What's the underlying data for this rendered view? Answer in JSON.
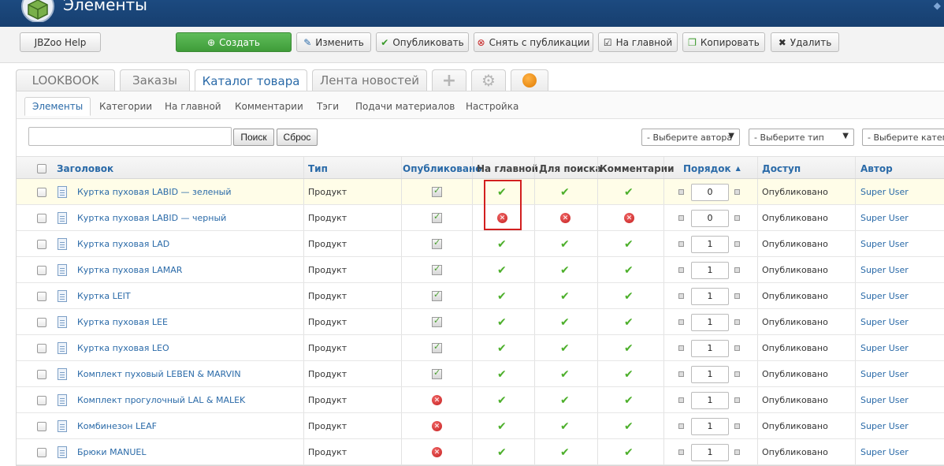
{
  "header": {
    "title": "Элементы",
    "logo_icon": "box-icon",
    "accent": "#1c4a80"
  },
  "toolbar": {
    "help_label": "JBZoo Help",
    "create_label": "Создать",
    "edit_label": "Изменить",
    "publish_label": "Опубликовать",
    "unpublish_label": "Снять с публикации",
    "featured_label": "На главной",
    "copy_label": "Копировать",
    "delete_label": "Удалить"
  },
  "app_tabs": [
    {
      "label": "LOOKBOOK",
      "active": false
    },
    {
      "label": "Заказы",
      "active": false
    },
    {
      "label": "Каталог товара",
      "active": true
    },
    {
      "label": "Лента новостей",
      "active": false
    }
  ],
  "app_tab_icons": [
    "plus-icon",
    "gear-icon",
    "puzzle-icon"
  ],
  "subtabs": [
    {
      "label": "Элементы",
      "active": true
    },
    {
      "label": "Категории",
      "active": false
    },
    {
      "label": "На главной",
      "active": false
    },
    {
      "label": "Комментарии",
      "active": false
    },
    {
      "label": "Тэги",
      "active": false
    },
    {
      "label": "Подачи материалов",
      "active": false
    },
    {
      "label": "Настройка",
      "active": false
    }
  ],
  "filters": {
    "search_value": "",
    "search_button": "Поиск",
    "reset_button": "Сброс",
    "author_select": "- Выберите автора",
    "type_select": "- Выберите тип",
    "category_select": "- Выберите категорию"
  },
  "columns": {
    "title": "Заголовок",
    "type": "Тип",
    "published": "Опубликовано",
    "frontpage": "На главной",
    "searchable": "Для поиска",
    "comments": "Комментарии",
    "order": "Порядок",
    "access": "Доступ",
    "author": "Автор"
  },
  "rows": [
    {
      "title": "Куртка пуховая LABID — зеленый",
      "type": "Продукт",
      "published": true,
      "frontpage": true,
      "searchable": true,
      "comments": true,
      "order": "0",
      "access": "Опубликовано",
      "author": "Super User",
      "highlight": true
    },
    {
      "title": "Куртка пуховая LABID — черный",
      "type": "Продукт",
      "published": true,
      "frontpage": false,
      "searchable": false,
      "comments": false,
      "order": "0",
      "access": "Опубликовано",
      "author": "Super User",
      "highlight": false
    },
    {
      "title": "Куртка пуховая LAD",
      "type": "Продукт",
      "published": true,
      "frontpage": true,
      "searchable": true,
      "comments": true,
      "order": "1",
      "access": "Опубликовано",
      "author": "Super User",
      "highlight": false
    },
    {
      "title": "Куртка пуховая LAMAR",
      "type": "Продукт",
      "published": true,
      "frontpage": true,
      "searchable": true,
      "comments": true,
      "order": "1",
      "access": "Опубликовано",
      "author": "Super User",
      "highlight": false
    },
    {
      "title": "Куртка LEIT",
      "type": "Продукт",
      "published": true,
      "frontpage": true,
      "searchable": true,
      "comments": true,
      "order": "1",
      "access": "Опубликовано",
      "author": "Super User",
      "highlight": false
    },
    {
      "title": "Куртка пуховая LEE",
      "type": "Продукт",
      "published": true,
      "frontpage": true,
      "searchable": true,
      "comments": true,
      "order": "1",
      "access": "Опубликовано",
      "author": "Super User",
      "highlight": false
    },
    {
      "title": "Куртка пуховая LEO",
      "type": "Продукт",
      "published": true,
      "frontpage": true,
      "searchable": true,
      "comments": true,
      "order": "1",
      "access": "Опубликовано",
      "author": "Super User",
      "highlight": false
    },
    {
      "title": "Комплект пуховый LEBEN & MARVIN",
      "type": "Продукт",
      "published": true,
      "frontpage": true,
      "searchable": true,
      "comments": true,
      "order": "1",
      "access": "Опубликовано",
      "author": "Super User",
      "highlight": false
    },
    {
      "title": "Комплект прогулочный LAL & MALEK",
      "type": "Продукт",
      "published": false,
      "frontpage": true,
      "searchable": true,
      "comments": true,
      "order": "1",
      "access": "Опубликовано",
      "author": "Super User",
      "highlight": false
    },
    {
      "title": "Комбинезон LEAF",
      "type": "Продукт",
      "published": false,
      "frontpage": true,
      "searchable": true,
      "comments": true,
      "order": "1",
      "access": "Опубликовано",
      "author": "Super User",
      "highlight": false
    },
    {
      "title": "Брюки MANUEL",
      "type": "Продукт",
      "published": false,
      "frontpage": true,
      "searchable": true,
      "comments": true,
      "order": "1",
      "access": "Опубликовано",
      "author": "Super User",
      "highlight": false
    }
  ]
}
